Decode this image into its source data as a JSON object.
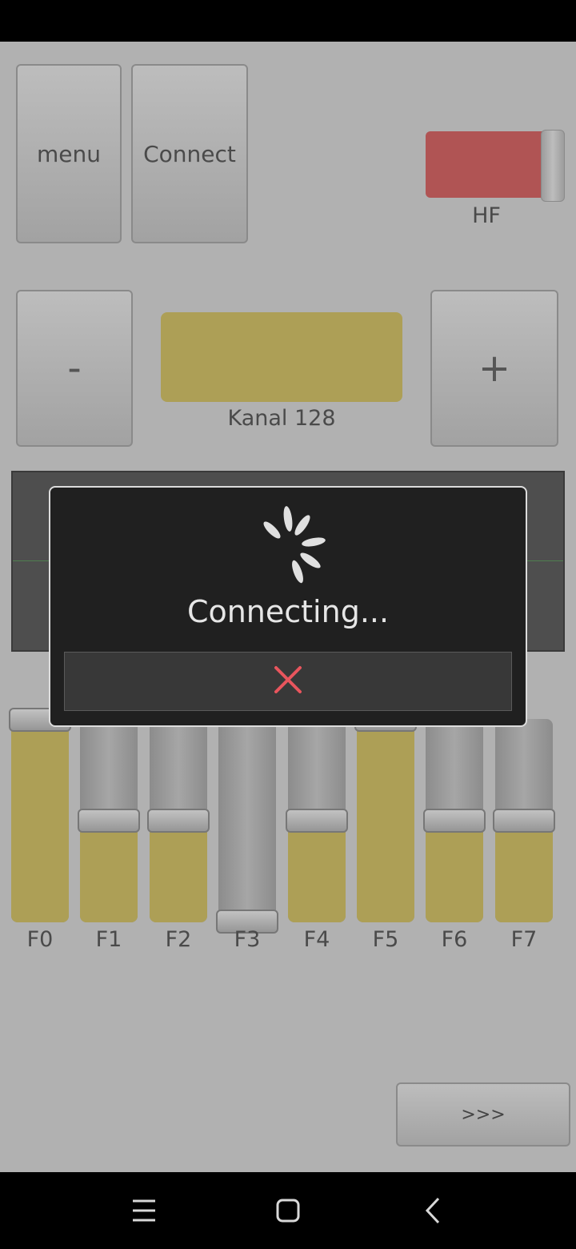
{
  "top_buttons": {
    "menu": "menu",
    "connect": "Connect"
  },
  "hf_toggle": {
    "label": "HF",
    "state": "on",
    "color": "#b05454"
  },
  "channel": {
    "minus": "-",
    "plus": "+",
    "label": "Kanal 128",
    "color": "#ad9f56"
  },
  "sliders": [
    {
      "label": "F0",
      "level": 1.0
    },
    {
      "label": "F1",
      "level": 0.5
    },
    {
      "label": "F2",
      "level": 0.5
    },
    {
      "label": "F3",
      "level": 0.0
    },
    {
      "label": "F4",
      "level": 0.5
    },
    {
      "label": "F5",
      "level": 1.0
    },
    {
      "label": "F6",
      "level": 0.5
    },
    {
      "label": "F7",
      "level": 0.5
    }
  ],
  "next_button": ">>>",
  "dialog": {
    "message": "Connecting...",
    "cancel_icon": "close-icon",
    "cancel_color": "#e8555d"
  },
  "nav": {
    "icons": [
      "menu-icon",
      "home-icon",
      "back-icon"
    ]
  }
}
